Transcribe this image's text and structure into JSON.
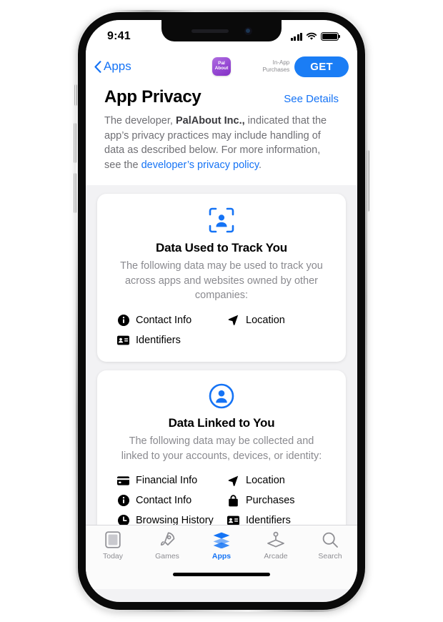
{
  "status_bar": {
    "time": "9:41",
    "signal_icon": "cellular-bars-icon",
    "wifi_icon": "wifi-icon",
    "battery_icon": "battery-full-icon"
  },
  "nav_bar": {
    "back_label": "Apps",
    "back_icon": "chevron-left-icon",
    "app_icon_line1": "Pal",
    "app_icon_line2": "About",
    "in_app_purchases_line1": "In-App",
    "in_app_purchases_line2": "Purchases",
    "get_label": "GET"
  },
  "header": {
    "title": "App Privacy",
    "see_details_label": "See Details",
    "intro_prefix": "The developer, ",
    "developer_name": "PalAbout Inc.,",
    "intro_middle": " indicated that the app’s privacy practices may include handling of data as described below. For more information, see the ",
    "privacy_policy_link": "developer’s privacy policy",
    "intro_suffix": "."
  },
  "cards": [
    {
      "icon": "person-in-viewfinder-icon",
      "title": "Data Used to Track You",
      "description": "The following data may be used to track you across apps and websites owned by other companies:",
      "categories": [
        {
          "label": "Contact Info",
          "icon": "info-circle-icon"
        },
        {
          "label": "Location",
          "icon": "location-arrow-icon"
        },
        {
          "label": "Identifiers",
          "icon": "id-card-icon"
        }
      ]
    },
    {
      "icon": "person-circle-icon",
      "title": "Data Linked to You",
      "description": "The following data may be collected and linked to your accounts, devices, or identity:",
      "categories": [
        {
          "label": "Financial Info",
          "icon": "credit-card-icon"
        },
        {
          "label": "Location",
          "icon": "location-arrow-icon"
        },
        {
          "label": "Contact Info",
          "icon": "info-circle-icon"
        },
        {
          "label": "Purchases",
          "icon": "shopping-bag-icon"
        },
        {
          "label": "Browsing History",
          "icon": "clock-icon"
        },
        {
          "label": "Identifiers",
          "icon": "id-card-icon"
        }
      ]
    }
  ],
  "tab_bar": {
    "items": [
      {
        "label": "Today",
        "icon": "today-card-icon",
        "active": false
      },
      {
        "label": "Games",
        "icon": "rocket-icon",
        "active": false
      },
      {
        "label": "Apps",
        "icon": "layers-icon",
        "active": true
      },
      {
        "label": "Arcade",
        "icon": "joystick-icon",
        "active": false
      },
      {
        "label": "Search",
        "icon": "magnifier-icon",
        "active": false
      }
    ]
  },
  "colors": {
    "accent_blue": "#1573f5",
    "app_icon_purple": "#9a4fd6",
    "background_gray": "#f2f2f4",
    "secondary_text": "#8a8a8f"
  }
}
